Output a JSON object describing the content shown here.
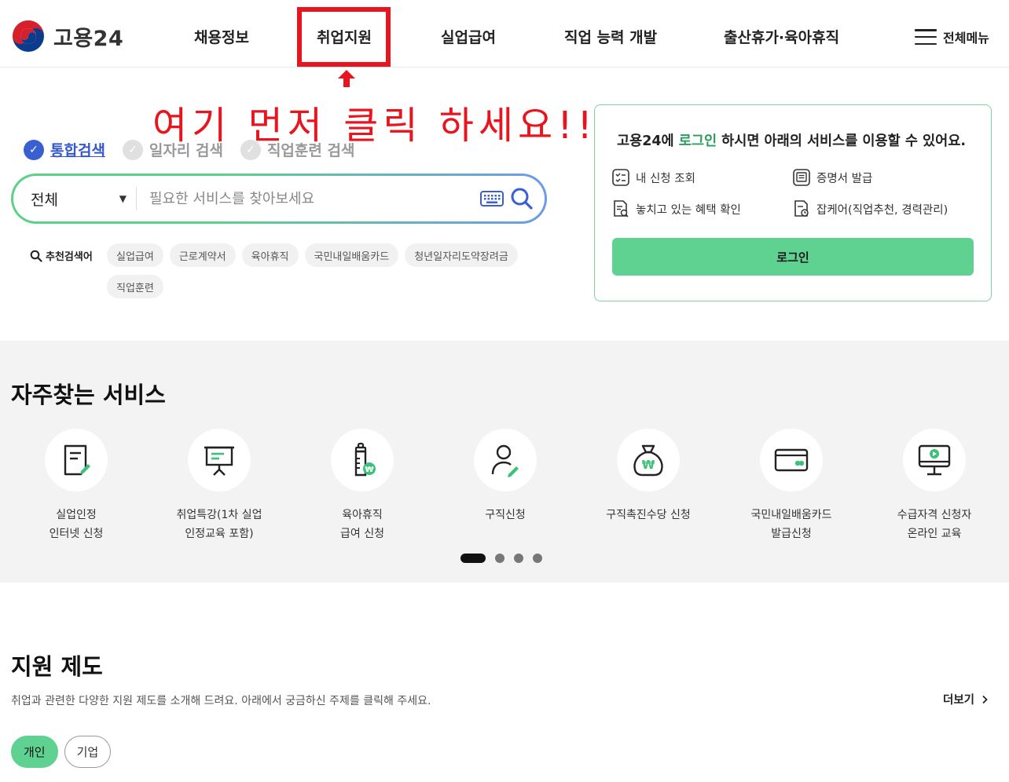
{
  "header": {
    "logo_text": "고용24",
    "nav": [
      "채용정보",
      "취업지원",
      "실업급여",
      "직업 능력 개발",
      "출산휴가·육아휴직"
    ],
    "all_menu_label": "전체메뉴"
  },
  "annotation": {
    "text": "여기 먼저 클릭 하세요!!",
    "color": "#e8141e"
  },
  "search": {
    "tabs": [
      "통합검색",
      "일자리 검색",
      "직업훈련 검색"
    ],
    "active_tab": "통합검색",
    "select_value": "전체",
    "placeholder": "필요한 서비스를 찾아보세요",
    "recommended_label": "추천검색어",
    "recommended_keywords": [
      "실업급여",
      "근로계약서",
      "육아휴직",
      "국민내일배움카드",
      "청년일자리도약장려금",
      "직업훈련"
    ]
  },
  "login_card": {
    "message_prefix": "고용24에 ",
    "message_highlight": "로그인",
    "message_suffix": " 하시면 아래의 서비스를 이용할 수 있어요.",
    "links": [
      "내 신청 조회",
      "증명서 발급",
      "놓치고 있는 혜택 확인",
      "잡케어(직업추천, 경력관리)"
    ],
    "button_label": "로그인"
  },
  "frequent_services": {
    "title": "자주찾는 서비스",
    "items": [
      {
        "line1": "실업인정",
        "line2": "인터넷 신청",
        "icon": "document-pen-icon"
      },
      {
        "line1": "취업특강(1차 실업",
        "line2": "인정교육 포함)",
        "icon": "presentation-board-icon"
      },
      {
        "line1": "육아휴직",
        "line2": "급여 신청",
        "icon": "baby-bottle-icon"
      },
      {
        "line1": "구직신청",
        "line2": "",
        "icon": "person-pen-icon"
      },
      {
        "line1": "구직촉진수당 신청",
        "line2": "",
        "icon": "money-bag-icon"
      },
      {
        "line1": "국민내일배움카드",
        "line2": "발급신청",
        "icon": "card-icon"
      },
      {
        "line1": "수급자격 신청자",
        "line2": "온라인 교육",
        "icon": "monitor-play-icon"
      }
    ],
    "carousel_pages": 4,
    "carousel_active": 1
  },
  "support": {
    "title": "지원 제도",
    "description": "취업과 관련한 다양한 지원 제도를 소개해 드려요. 아래에서 궁금하신 주제를 클릭해 주세요.",
    "more_label": "더보기",
    "tabs": [
      "개인",
      "기업"
    ],
    "active_tab": "개인"
  },
  "colors": {
    "accent_green": "#5fd291",
    "login_green_text": "#2a9d5c",
    "tab_blue": "#3a5fd1",
    "annotation_red": "#e8141e"
  }
}
